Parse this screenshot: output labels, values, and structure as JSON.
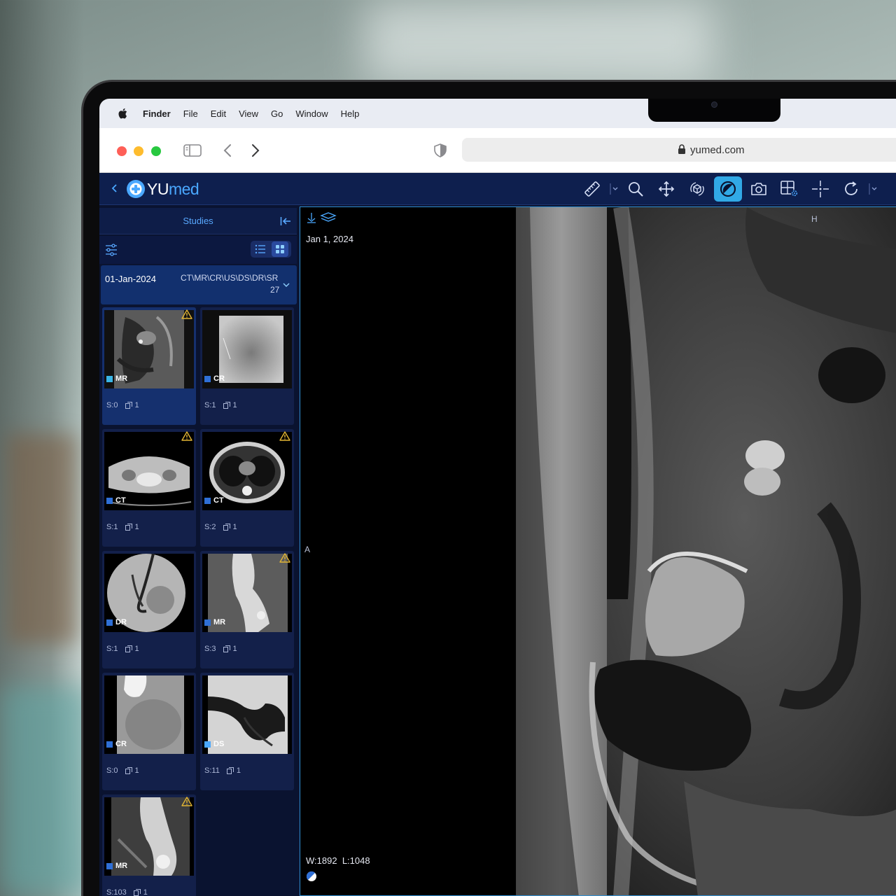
{
  "menubar": {
    "items": [
      "Finder",
      "File",
      "Edit",
      "View",
      "Go",
      "Window",
      "Help"
    ]
  },
  "browser": {
    "url": "yumed.com"
  },
  "app": {
    "logo": {
      "brand_a": "YU",
      "brand_b": "med"
    },
    "tools": [
      {
        "icon": "ruler-icon",
        "dropdown": true
      },
      {
        "icon": "zoom-icon"
      },
      {
        "icon": "pan-icon"
      },
      {
        "icon": "rotate-3d-icon"
      },
      {
        "icon": "contrast-icon",
        "active": true
      },
      {
        "icon": "camera-icon"
      },
      {
        "icon": "layout-settings-icon"
      },
      {
        "icon": "crosshair-icon"
      },
      {
        "icon": "reset-icon",
        "dropdown": true
      }
    ],
    "accent": "#31a9e6"
  },
  "sidebar": {
    "title": "Studies",
    "study": {
      "date": "01-Jan-2024",
      "modalities": "CT\\MR\\CR\\US\\DS\\DR\\SR",
      "count": "27"
    },
    "series": [
      {
        "modality": "MR",
        "series": "S:0",
        "instances": "1",
        "warning": true,
        "selected": true
      },
      {
        "modality": "CR",
        "series": "S:1",
        "instances": "1",
        "warning": false
      },
      {
        "modality": "CT",
        "series": "S:1",
        "instances": "1",
        "warning": true
      },
      {
        "modality": "CT",
        "series": "S:2",
        "instances": "1",
        "warning": true
      },
      {
        "modality": "DR",
        "series": "S:1",
        "instances": "1",
        "warning": false
      },
      {
        "modality": "MR",
        "series": "S:3",
        "instances": "1",
        "warning": true
      },
      {
        "modality": "CR",
        "series": "S:0",
        "instances": "1",
        "warning": false
      },
      {
        "modality": "DS",
        "series": "S:11",
        "instances": "1",
        "warning": false
      },
      {
        "modality": "MR",
        "series": "S:103",
        "instances": "1",
        "warning": true
      }
    ]
  },
  "viewer": {
    "date": "Jan 1, 2024",
    "orient_left": "A",
    "orient_top": "H",
    "window_label": "W:",
    "window": "1892",
    "level_label": "L:",
    "level": "1048"
  }
}
